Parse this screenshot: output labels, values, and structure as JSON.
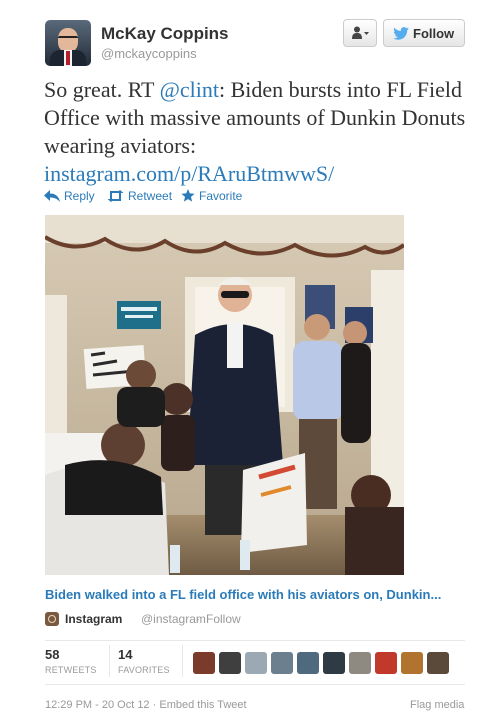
{
  "author": {
    "name": "McKay Coppins",
    "handle": "@mckaycoppins"
  },
  "header": {
    "follow_label": "Follow",
    "user_menu_icon": "user-dropdown-icon"
  },
  "tweet": {
    "line1": "So great. RT ",
    "mention": "@clint",
    "line1_rest": ": Biden bursts into FL Field Office with massive amounts of Dunkin Donuts wearing aviators:",
    "url": "instagram.com/p/RAruBtmwwS/"
  },
  "actions": {
    "reply": "Reply",
    "retweet": "Retweet",
    "favorite": "Favorite"
  },
  "media": {
    "caption": "Biden walked into a FL field office with his aviators on, Dunkin...",
    "source_name": "Instagram",
    "source_handle": "@instagram",
    "separator": "·",
    "source_follow": "Follow",
    "photo_sign_left": "HISPANICS FOR OBAMA",
    "photo_sign_paper": "Sí, Se puede"
  },
  "stats": {
    "retweets_count": "58",
    "retweets_label": "RETWEETS",
    "favorites_count": "14",
    "favorites_label": "FAVORITES"
  },
  "footer": {
    "timestamp": "12:29 PM - 20 Oct 12",
    "separator": "·",
    "embed": "Embed this Tweet",
    "flag": "Flag media"
  },
  "colors": {
    "link": "#2b7bb9",
    "muted": "#999999",
    "text": "#333333"
  }
}
